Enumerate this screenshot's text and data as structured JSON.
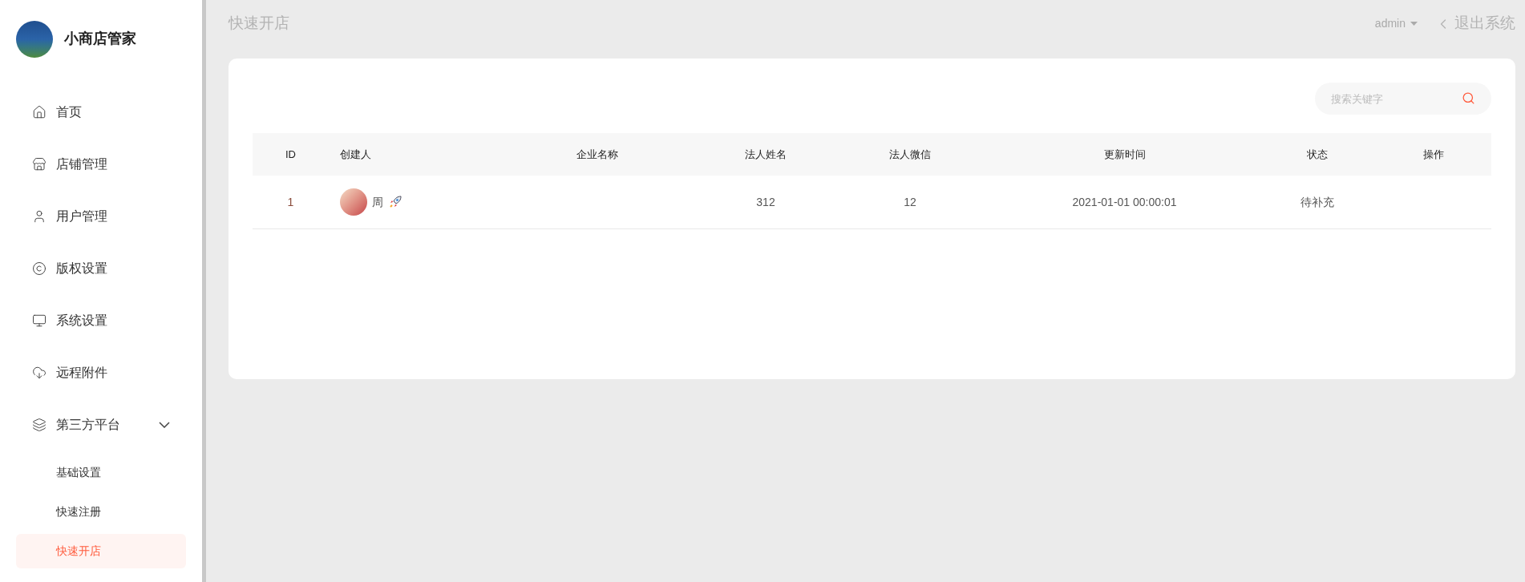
{
  "sidebar": {
    "app_name": "小商店管家",
    "items": [
      {
        "label": "首页"
      },
      {
        "label": "店铺管理"
      },
      {
        "label": "用户管理"
      },
      {
        "label": "版权设置"
      },
      {
        "label": "系统设置"
      },
      {
        "label": "远程附件"
      },
      {
        "label": "第三方平台",
        "expanded": true,
        "children": [
          {
            "label": "基础设置",
            "selected": false
          },
          {
            "label": "快速注册",
            "selected": false
          },
          {
            "label": "快速开店",
            "selected": true
          }
        ]
      }
    ]
  },
  "header": {
    "title": "快速开店",
    "user": "admin",
    "logout": "退出系统"
  },
  "search": {
    "placeholder": "搜索关键字"
  },
  "table": {
    "columns": [
      "ID",
      "创建人",
      "企业名称",
      "法人姓名",
      "法人微信",
      "更新时间",
      "状态",
      "操作"
    ],
    "rows": [
      {
        "id": "1",
        "creator": "周",
        "company": "",
        "legal_name": "312",
        "legal_wechat": "12",
        "updated": "2021-01-01 00:00:01",
        "status": "待补充"
      }
    ]
  }
}
